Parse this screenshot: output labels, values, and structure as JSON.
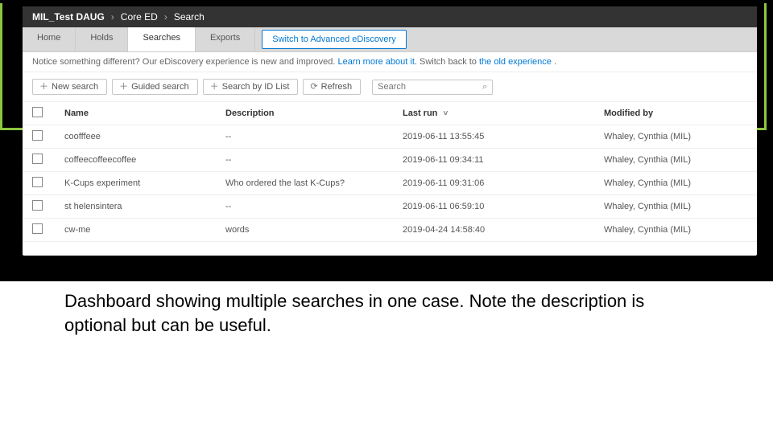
{
  "breadcrumb": [
    "MIL_Test DAUG",
    "Core ED",
    "Search"
  ],
  "tabs": [
    {
      "label": "Home"
    },
    {
      "label": "Holds"
    },
    {
      "label": "Searches",
      "active": true
    },
    {
      "label": "Exports"
    }
  ],
  "advanced_link": "Switch to Advanced eDiscovery",
  "notice": {
    "prefix": "Notice something different? Our eDiscovery experience is new and improved. ",
    "learn_more": "Learn more about it.",
    "middle": " Switch back to ",
    "old_link": "the old experience",
    "suffix": "."
  },
  "toolbar": {
    "new_search": "New search",
    "guided_search": "Guided search",
    "search_by_id": "Search by ID List",
    "refresh": "Refresh",
    "search_placeholder": "Search"
  },
  "columns": {
    "name": "Name",
    "description": "Description",
    "last_run": "Last run",
    "modified_by": "Modified by"
  },
  "rows": [
    {
      "name": "coofffeee",
      "description": "--",
      "last_run": "2019-06-11 13:55:45",
      "modified_by": "Whaley, Cynthia (MIL)"
    },
    {
      "name": "coffeecoffeecoffee",
      "description": "--",
      "last_run": "2019-06-11 09:34:11",
      "modified_by": "Whaley, Cynthia (MIL)"
    },
    {
      "name": "K-Cups experiment",
      "description": "Who ordered the last K-Cups?",
      "last_run": "2019-06-11 09:31:06",
      "modified_by": "Whaley, Cynthia (MIL)"
    },
    {
      "name": "st helensintera",
      "description": "--",
      "last_run": "2019-06-11 06:59:10",
      "modified_by": "Whaley, Cynthia (MIL)"
    },
    {
      "name": "cw-me",
      "description": "words",
      "last_run": "2019-04-24 14:58:40",
      "modified_by": "Whaley, Cynthia (MIL)"
    }
  ],
  "caption": "Dashboard showing multiple searches in one case. Note the description is optional but can be useful."
}
